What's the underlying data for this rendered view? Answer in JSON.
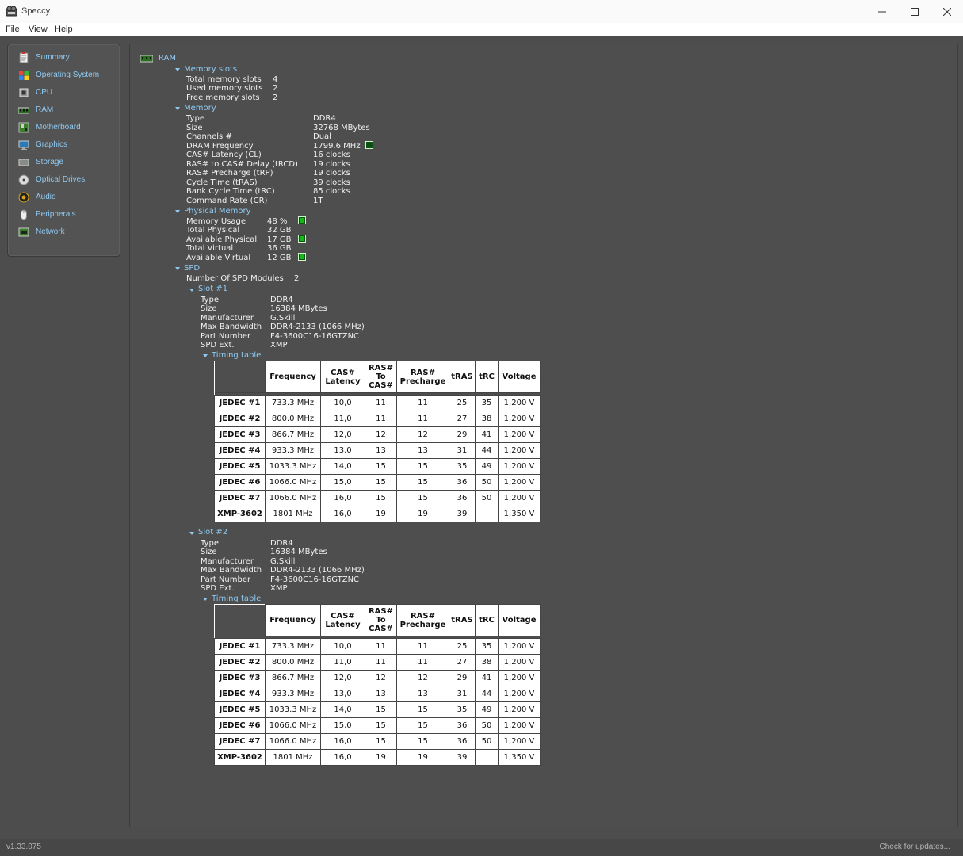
{
  "window": {
    "title": "Speccy"
  },
  "menu": [
    "File",
    "View",
    "Help"
  ],
  "sidebar": [
    {
      "label": "Summary",
      "icon": "summary-icon"
    },
    {
      "label": "Operating System",
      "icon": "windows-icon"
    },
    {
      "label": "CPU",
      "icon": "cpu-icon"
    },
    {
      "label": "RAM",
      "icon": "ram-icon"
    },
    {
      "label": "Motherboard",
      "icon": "motherboard-icon"
    },
    {
      "label": "Graphics",
      "icon": "monitor-icon"
    },
    {
      "label": "Storage",
      "icon": "storage-icon"
    },
    {
      "label": "Optical Drives",
      "icon": "disc-icon"
    },
    {
      "label": "Audio",
      "icon": "speaker-icon"
    },
    {
      "label": "Peripherals",
      "icon": "mouse-icon"
    },
    {
      "label": "Network",
      "icon": "network-icon"
    }
  ],
  "main": {
    "heading": "RAM",
    "memory_slots": {
      "title": "Memory slots",
      "rows": [
        [
          "Total memory slots",
          "4"
        ],
        [
          "Used memory slots",
          "2"
        ],
        [
          "Free memory slots",
          "2"
        ]
      ]
    },
    "memory": {
      "title": "Memory",
      "rows": [
        [
          "Type",
          "DDR4"
        ],
        [
          "Size",
          "32768 MBytes"
        ],
        [
          "Channels #",
          "Dual"
        ],
        [
          "DRAM Frequency",
          "1799.6 MHz"
        ],
        [
          "CAS# Latency (CL)",
          "16 clocks"
        ],
        [
          "RAS# to CAS# Delay (tRCD)",
          "19 clocks"
        ],
        [
          "RAS# Precharge (tRP)",
          "19 clocks"
        ],
        [
          "Cycle Time (tRAS)",
          "39 clocks"
        ],
        [
          "Bank Cycle Time (tRC)",
          "85 clocks"
        ],
        [
          "Command Rate (CR)",
          "1T"
        ]
      ]
    },
    "physical_memory": {
      "title": "Physical Memory",
      "rows": [
        [
          "Memory Usage",
          "48 %"
        ],
        [
          "Total Physical",
          "32 GB"
        ],
        [
          "Available Physical",
          "17 GB"
        ],
        [
          "Total Virtual",
          "36 GB"
        ],
        [
          "Available Virtual",
          "12 GB"
        ]
      ]
    },
    "spd": {
      "title": "SPD",
      "modules_label": "Number Of SPD Modules",
      "modules_value": "2",
      "slots": [
        {
          "title": "Slot #1",
          "rows": [
            [
              "Type",
              "DDR4"
            ],
            [
              "Size",
              "16384 MBytes"
            ],
            [
              "Manufacturer",
              "G.Skill"
            ],
            [
              "Max Bandwidth",
              "DDR4-2133 (1066 MHz)"
            ],
            [
              "Part Number",
              "F4-3600C16-16GTZNC"
            ],
            [
              "SPD Ext.",
              "XMP"
            ]
          ],
          "timing_title": "Timing table"
        },
        {
          "title": "Slot #2",
          "rows": [
            [
              "Type",
              "DDR4"
            ],
            [
              "Size",
              "16384 MBytes"
            ],
            [
              "Manufacturer",
              "G.Skill"
            ],
            [
              "Max Bandwidth",
              "DDR4-2133 (1066 MHz)"
            ],
            [
              "Part Number",
              "F4-3600C16-16GTZNC"
            ],
            [
              "SPD Ext.",
              "XMP"
            ]
          ],
          "timing_title": "Timing table"
        }
      ],
      "timing_headers": [
        "Frequency",
        "CAS# Latency",
        "RAS# To CAS#",
        "RAS# Precharge",
        "tRAS",
        "tRC",
        "Voltage"
      ],
      "timing_rows": [
        [
          "JEDEC #1",
          "733.3 MHz",
          "10,0",
          "11",
          "11",
          "25",
          "35",
          "1,200 V"
        ],
        [
          "JEDEC #2",
          "800.0 MHz",
          "11,0",
          "11",
          "11",
          "27",
          "38",
          "1,200 V"
        ],
        [
          "JEDEC #3",
          "866.7 MHz",
          "12,0",
          "12",
          "12",
          "29",
          "41",
          "1,200 V"
        ],
        [
          "JEDEC #4",
          "933.3 MHz",
          "13,0",
          "13",
          "13",
          "31",
          "44",
          "1,200 V"
        ],
        [
          "JEDEC #5",
          "1033.3 MHz",
          "14,0",
          "15",
          "15",
          "35",
          "49",
          "1,200 V"
        ],
        [
          "JEDEC #6",
          "1066.0 MHz",
          "15,0",
          "15",
          "15",
          "36",
          "50",
          "1,200 V"
        ],
        [
          "JEDEC #7",
          "1066.0 MHz",
          "16,0",
          "15",
          "15",
          "36",
          "50",
          "1,200 V"
        ],
        [
          "XMP-3602",
          "1801 MHz",
          "16,0",
          "19",
          "19",
          "39",
          "",
          "1,350 V"
        ]
      ]
    }
  },
  "status": {
    "version": "v1.33.075",
    "check": "Check for updates..."
  },
  "colors": {
    "accent": "#8fcaf2",
    "background": "#4d4d4d",
    "text": "#f1f1f1",
    "indicator": "#17b71b"
  }
}
